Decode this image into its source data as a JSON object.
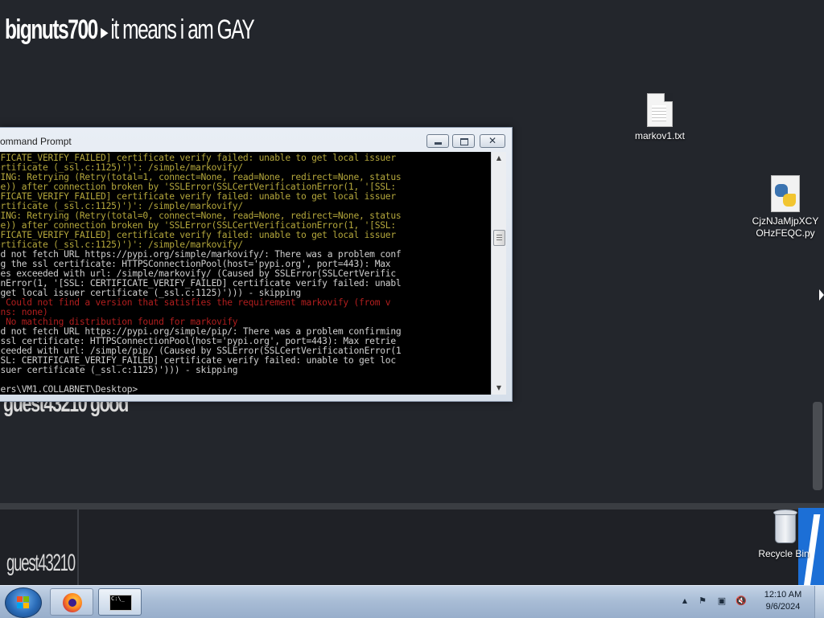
{
  "stream": {
    "chat_user": "bignuts700",
    "chat_sep": "▸",
    "chat_message": "it means i am GAY",
    "chat_line2": "guest43210 good",
    "bottom_user": "guest43210"
  },
  "desktop": {
    "icons": [
      {
        "label": "markov1.txt",
        "icon": "text-file-icon"
      },
      {
        "label": "CjzNJaMjpXCYOHzFEQC.py",
        "icon": "python-file-icon"
      },
      {
        "label": "Recycle Bin",
        "icon": "recycle-bin-icon"
      }
    ]
  },
  "cmd": {
    "title": "ommand Prompt",
    "close_glyph": "✕",
    "lines": [
      {
        "text": "IFICATE_VERIFY_FAILED] certificate verify failed: unable to get local issuer",
        "color": "yellow"
      },
      {
        "text": "ertificate (_ssl.c:1125)')': /simple/markovify/",
        "color": "yellow"
      },
      {
        "text": "NING: Retrying (Retry(total=1, connect=None, read=None, redirect=None, status",
        "color": "yellow"
      },
      {
        "text": "ne)) after connection broken by 'SSLError(SSLCertVerificationError(1, '[SSL:",
        "color": "yellow"
      },
      {
        "text": "IFICATE_VERIFY_FAILED] certificate verify failed: unable to get local issuer",
        "color": "yellow"
      },
      {
        "text": "ertificate (_ssl.c:1125)')': /simple/markovify/",
        "color": "yellow"
      },
      {
        "text": "NING: Retrying (Retry(total=0, connect=None, read=None, redirect=None, status",
        "color": "yellow"
      },
      {
        "text": "ne)) after connection broken by 'SSLError(SSLCertVerificationError(1, '[SSL:",
        "color": "yellow"
      },
      {
        "text": "IFICATE_VERIFY_FAILED] certificate verify failed: unable to get local issuer",
        "color": "yellow"
      },
      {
        "text": "ertificate (_ssl.c:1125)')': /simple/markovify/",
        "color": "yellow"
      },
      {
        "text": "ld not fetch URL https://pypi.org/simple/markovify/: There was a problem conf",
        "color": "white"
      },
      {
        "text": "ng the ssl certificate: HTTPSConnectionPool(host='pypi.org', port=443): Max",
        "color": "white"
      },
      {
        "text": "ies exceeded with url: /simple/markovify/ (Caused by SSLError(SSLCertVerific",
        "color": "white"
      },
      {
        "text": "onError(1, '[SSL: CERTIFICATE_VERIFY_FAILED] certificate verify failed: unabl",
        "color": "white"
      },
      {
        "text": " get local issuer certificate (_ssl.c:1125)'))) - skipping",
        "color": "white"
      },
      {
        "text": ": Could not find a version that satisfies the requirement markovify (from v",
        "color": "red"
      },
      {
        "text": "ons: none)",
        "color": "red"
      },
      {
        "text": ": No matching distribution found for markovify",
        "color": "red"
      },
      {
        "text": "ld not fetch URL https://pypi.org/simple/pip/: There was a problem confirming",
        "color": "white"
      },
      {
        "text": " ssl certificate: HTTPSConnectionPool(host='pypi.org', port=443): Max retrie",
        "color": "white"
      },
      {
        "text": "xceeded with url: /simple/pip/ (Caused by SSLError(SSLCertVerificationError(1",
        "color": "white"
      },
      {
        "text": "SSL: CERTIFICATE_VERIFY_FAILED] certificate verify failed: unable to get loc",
        "color": "white"
      },
      {
        "text": "ssuer certificate (_ssl.c:1125)'))) - skipping",
        "color": "white"
      },
      {
        "text": "",
        "color": "white"
      },
      {
        "text": "sers\\VM1.COLLABNET\\Desktop>",
        "color": "white"
      }
    ]
  },
  "taskbar": {
    "apps": [
      {
        "name": "Firefox",
        "icon": "firefox-icon"
      },
      {
        "name": "Command Prompt",
        "icon": "cmd-icon"
      }
    ],
    "cmd_glyph_text": "C:\\_",
    "tray": {
      "up_arrow": "▲",
      "flag": "⚑",
      "network": "▣",
      "volume": "🔇"
    },
    "time": "12:10 AM",
    "date": "9/6/2024"
  },
  "colors": {
    "yellow": "#b4a73c",
    "white": "#d0d0d0",
    "red": "#b21e1e"
  }
}
